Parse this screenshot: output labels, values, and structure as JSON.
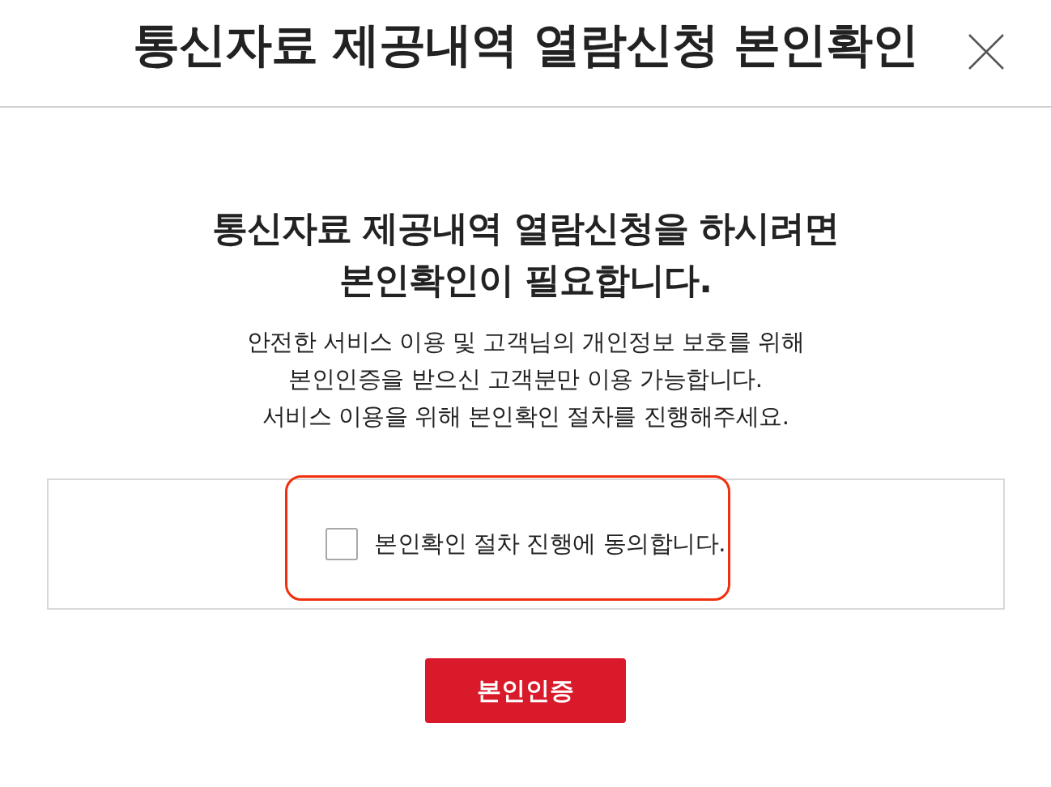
{
  "dialog": {
    "title": "통신자료 제공내역 열람신청 본인확인"
  },
  "heading_lines": [
    "통신자료 제공내역 열람신청을 하시려면",
    "본인확인이 필요합니다."
  ],
  "description_lines": [
    "안전한 서비스 이용 및 고객님의 개인정보 보호를 위해",
    "본인인증을 받으신 고객분만 이용 가능합니다.",
    "서비스 이용을 위해 본인확인 절차를 진행해주세요."
  ],
  "agreement": {
    "label": "본인확인 절차 진행에 동의합니다.",
    "checked": false,
    "highlighted": true
  },
  "buttons": [
    {
      "label": "본인인증",
      "kind": "primary"
    }
  ]
}
